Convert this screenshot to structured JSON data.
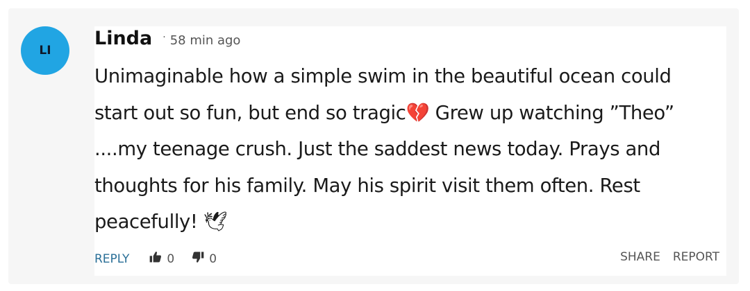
{
  "comment": {
    "avatar_initials": "LI",
    "avatar_color": "#21a5e3",
    "author": "Linda",
    "separator": "·",
    "time": "58 min ago",
    "text": "Unimaginable how a simple swim in the beautiful ocean could start out so fun, but end so tragic💔 Grew up watching ”Theo” ....my teenage crush. Just the saddest news today. Prays and thoughts for his family. May his spirit visit them often. Rest peacefully! 🕊",
    "actions": {
      "reply_label": "REPLY",
      "upvote_count": "0",
      "downvote_count": "0",
      "share_label": "SHARE",
      "report_label": "REPORT"
    }
  },
  "colors": {
    "reply_link": "#2a6f97",
    "card_background": "#f6f6f6"
  },
  "icons": {
    "upvote": "thumbs-up-icon",
    "downvote": "thumbs-down-icon"
  }
}
